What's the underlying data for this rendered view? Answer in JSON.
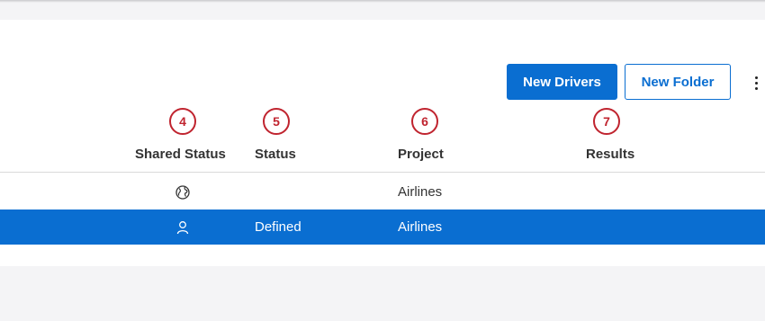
{
  "toolbar": {
    "new_drivers_label": "New Drivers",
    "new_folder_label": "New Folder",
    "more_icon": "kebab-vertical-icon"
  },
  "annotations": [
    "4",
    "5",
    "6",
    "7"
  ],
  "table": {
    "columns": [
      "Shared Status",
      "Status",
      "Project",
      "Results"
    ],
    "rows": [
      {
        "shared_icon": "globe-icon",
        "status": "",
        "project": "Airlines",
        "results": "",
        "selected": false
      },
      {
        "shared_icon": "user-icon",
        "status": "Defined",
        "project": "Airlines",
        "results": "",
        "selected": true
      }
    ]
  },
  "colors": {
    "accent": "#0a6ed1",
    "marker": "#c0242f",
    "background": "#f4f4f6"
  }
}
